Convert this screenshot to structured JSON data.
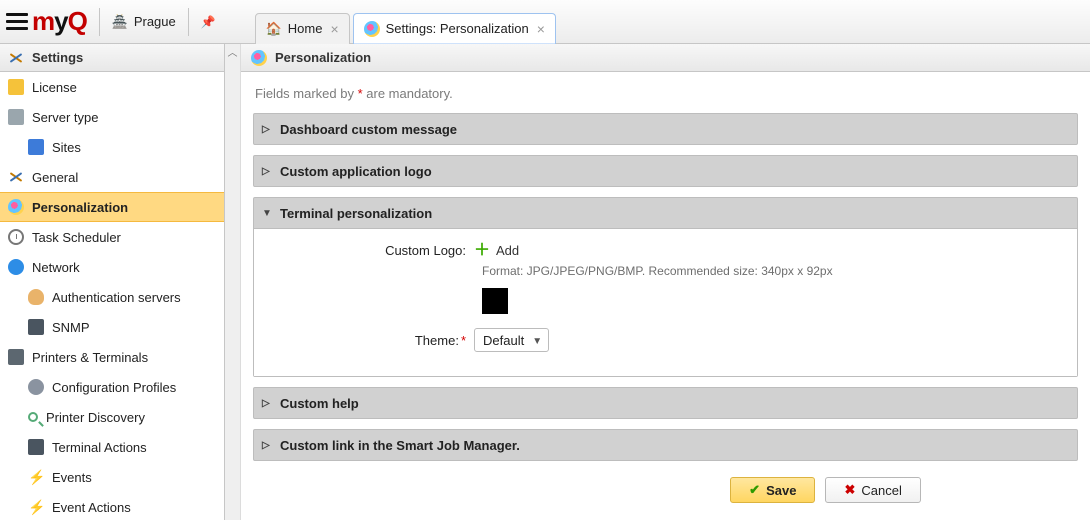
{
  "toolbar": {
    "location_label": "Prague"
  },
  "tabs": [
    {
      "label": "Home"
    },
    {
      "label": "Settings: Personalization"
    }
  ],
  "sidebar": {
    "title": "Settings",
    "items": [
      {
        "label": "License",
        "icon": "folder",
        "indent": 0
      },
      {
        "label": "Server type",
        "icon": "server",
        "indent": 0
      },
      {
        "label": "Sites",
        "icon": "site",
        "indent": 1
      },
      {
        "label": "General",
        "icon": "wrench-screw",
        "indent": 0
      },
      {
        "label": "Personalization",
        "icon": "palette",
        "indent": 0,
        "selected": true
      },
      {
        "label": "Task Scheduler",
        "icon": "clock",
        "indent": 0
      },
      {
        "label": "Network",
        "icon": "globe",
        "indent": 0
      },
      {
        "label": "Authentication servers",
        "icon": "user",
        "indent": 1
      },
      {
        "label": "SNMP",
        "icon": "screen",
        "indent": 1
      },
      {
        "label": "Printers & Terminals",
        "icon": "printer",
        "indent": 0
      },
      {
        "label": "Configuration Profiles",
        "icon": "gear",
        "indent": 1
      },
      {
        "label": "Printer Discovery",
        "icon": "search",
        "indent": 1
      },
      {
        "label": "Terminal Actions",
        "icon": "screen",
        "indent": 1
      },
      {
        "label": "Events",
        "icon": "bolt",
        "indent": 1
      },
      {
        "label": "Event Actions",
        "icon": "bolt",
        "indent": 1
      }
    ]
  },
  "page": {
    "title": "Personalization",
    "mandatory_prefix": "Fields marked by ",
    "mandatory_mark": "*",
    "mandatory_suffix": " are mandatory."
  },
  "panels": {
    "dash": {
      "title": "Dashboard custom message",
      "open": false
    },
    "logo": {
      "title": "Custom application logo",
      "open": false
    },
    "term": {
      "title": "Terminal personalization",
      "open": true,
      "custom_logo_label": "Custom Logo:",
      "add_label": "Add",
      "format_hint": "Format: JPG/JPEG/PNG/BMP. Recommended size: 340px x 92px",
      "theme_label": "Theme:",
      "theme_value": "Default"
    },
    "help": {
      "title": "Custom help",
      "open": false
    },
    "sjm": {
      "title": "Custom link in the Smart Job Manager.",
      "open": false
    }
  },
  "buttons": {
    "save": "Save",
    "cancel": "Cancel"
  }
}
